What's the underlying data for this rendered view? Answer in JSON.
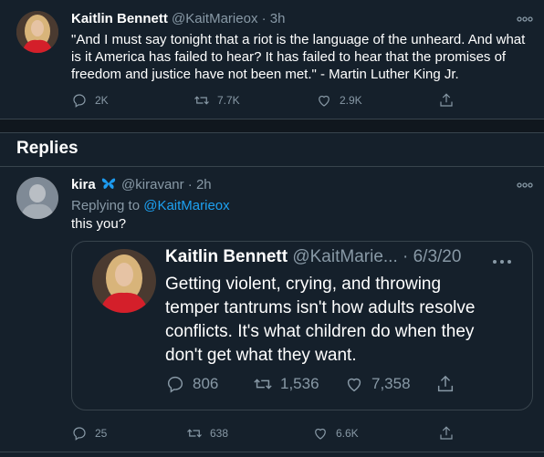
{
  "main_tweet": {
    "name": "Kaitlin Bennett",
    "handle": "@KaitMarieox · 3h",
    "text_lines": [
      "\"And I must say tonight that a riot is the language of the unheard. And what",
      "is it America has failed to hear? It has failed to hear that the promises of",
      "freedom and justice have not been met.\" - Martin Luther King Jr."
    ],
    "replies": "2K",
    "retweets": "7.7K",
    "likes": "2.9K"
  },
  "replies_section": {
    "title": "Replies"
  },
  "reply_tweet": {
    "name": "kira",
    "handle": "@kiravanr · 2h",
    "replying_prefix": "Replying to ",
    "replying_to": "@KaitMarieox",
    "text": "this you?",
    "replies": "25",
    "retweets": "638",
    "likes": "6.6K",
    "quoted": {
      "name": "Kaitlin Bennett",
      "handle": "@KaitMarie... · 6/3/20",
      "text_lines": [
        "Getting violent, crying, and throwing",
        "temper tantrums isn't how adults resolve",
        "conflicts. It's what children do when they",
        "don't get what they want."
      ],
      "replies": "806",
      "retweets": "1,536",
      "likes": "7,358"
    }
  },
  "colors": {
    "background": "#15202b",
    "border": "#38444d",
    "muted": "#8899a6",
    "link": "#1da1f2",
    "butterfly": "#1d9bf0"
  },
  "icons": [
    "reply-icon",
    "retweet-icon",
    "like-icon",
    "share-icon",
    "more-icon",
    "butterfly-emoji-icon"
  ]
}
